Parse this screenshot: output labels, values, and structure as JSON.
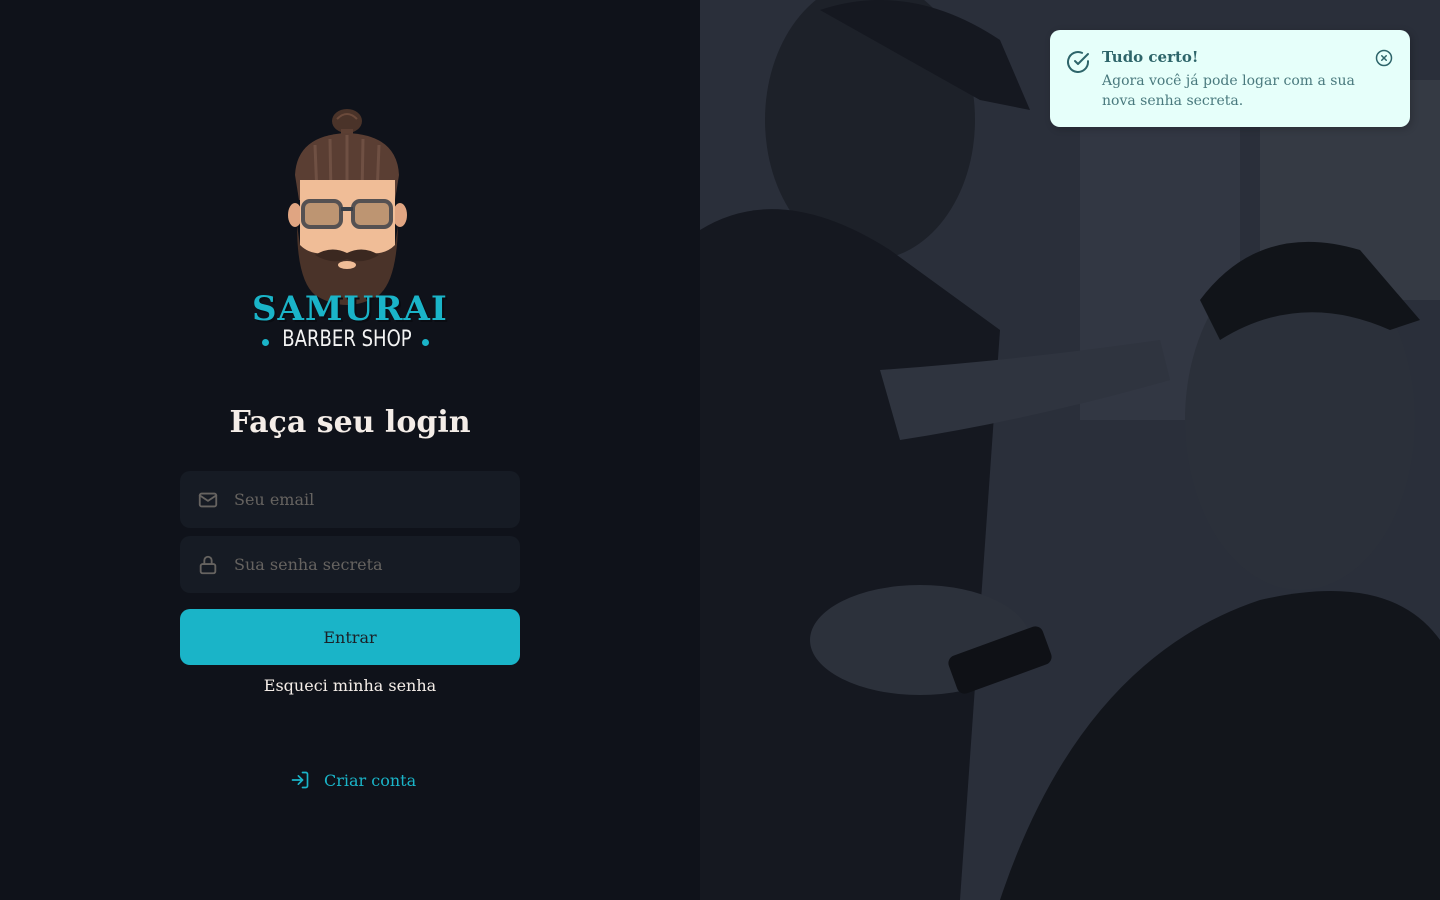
{
  "brand": {
    "name": "SAMURAI",
    "subtitle": "BARBER SHOP"
  },
  "login": {
    "heading": "Faça seu login",
    "email_placeholder": "Seu email",
    "password_placeholder": "Sua senha secreta",
    "submit_label": "Entrar",
    "forgot_label": "Esqueci minha senha",
    "signup_label": "Criar conta"
  },
  "toast": {
    "title": "Tudo certo!",
    "description": "Agora você já pode logar com a sua nova senha secreta."
  },
  "icons": {
    "email": "mail-icon",
    "password": "lock-icon",
    "signup": "log-in-icon",
    "toast_status": "check-circle-icon",
    "toast_close": "x-circle-icon"
  },
  "colors": {
    "accent": "#1ab4c8",
    "background": "#0f121a",
    "input_background": "#161b24",
    "text": "#f4ede8",
    "placeholder": "#666360",
    "toast_background": "#e6fffa",
    "toast_text": "#2e656a"
  }
}
